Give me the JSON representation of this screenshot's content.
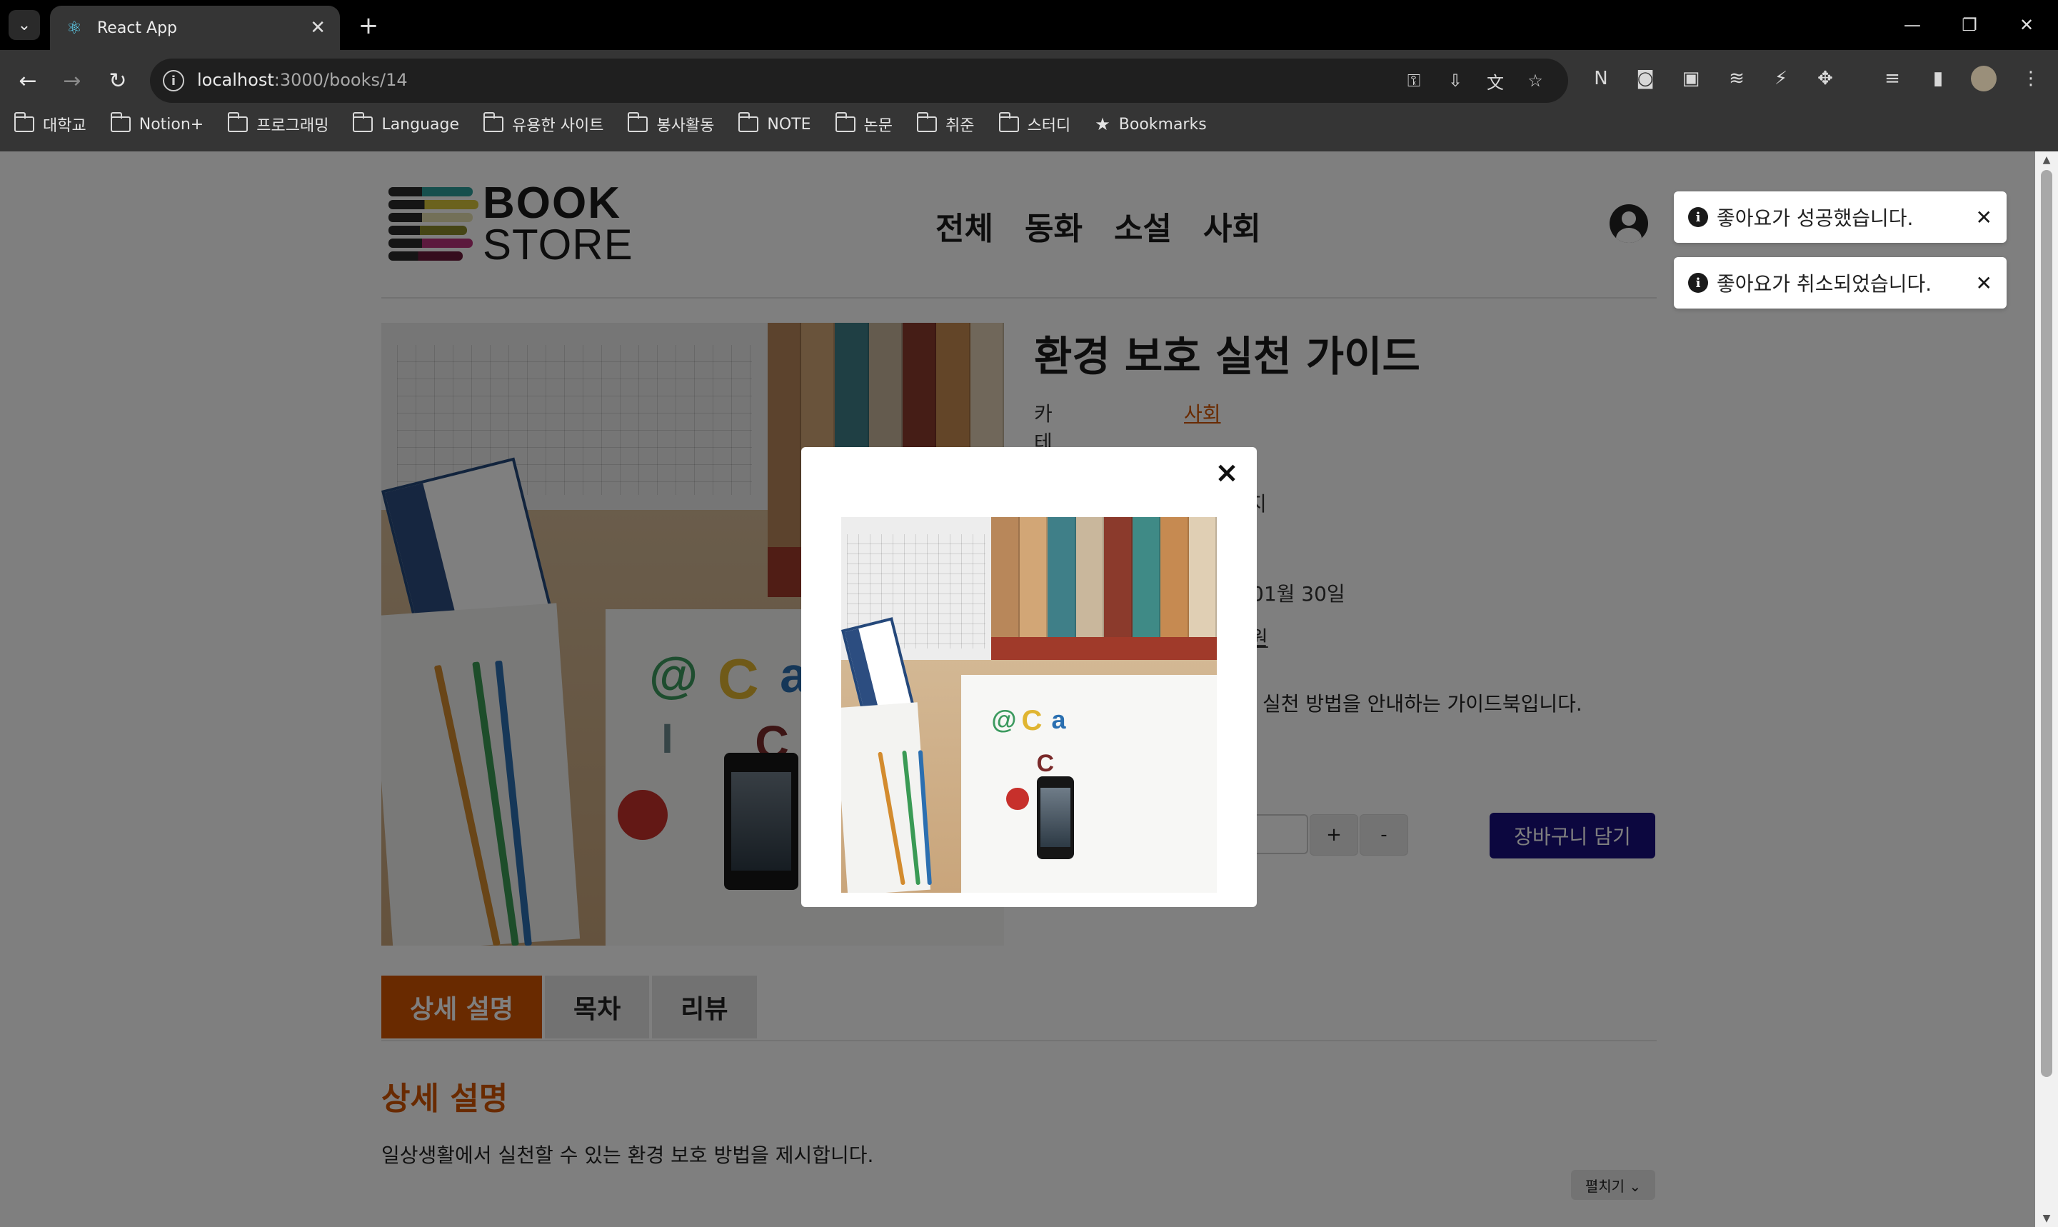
{
  "browser": {
    "tab_title": "React App",
    "url_host": "localhost",
    "url_rest": ":3000/books/14",
    "bookmarks": [
      {
        "label": "대학교",
        "type": "folder"
      },
      {
        "label": "Notion+",
        "type": "folder"
      },
      {
        "label": "프로그래밍",
        "type": "folder"
      },
      {
        "label": "Language",
        "type": "folder"
      },
      {
        "label": "유용한 사이트",
        "type": "folder"
      },
      {
        "label": "봉사활동",
        "type": "folder"
      },
      {
        "label": "NOTE",
        "type": "folder"
      },
      {
        "label": "논문",
        "type": "folder"
      },
      {
        "label": "취준",
        "type": "folder"
      },
      {
        "label": "스터디",
        "type": "folder"
      },
      {
        "label": "Bookmarks",
        "type": "star"
      }
    ]
  },
  "header": {
    "logo_line1": "BOOK",
    "logo_line2": "STORE",
    "logo_colors": [
      "#2d9f9a",
      "#d7c43a",
      "#e7e1b0",
      "#8a8a2a",
      "#b9327a",
      "#6b1a3a"
    ],
    "nav": [
      "전체",
      "동화",
      "소설",
      "사회"
    ]
  },
  "book": {
    "title": "환경 보호 실천 가이드",
    "category_label": "카테고리",
    "category_value": "사회",
    "partial_lines": [
      "지",
      "01월 30일",
      "원"
    ],
    "summary_visible": "실천 방법을 안내하는 가이드북입니다.",
    "cart_button": "장바구니 담기",
    "plus_label": "+",
    "minus_label": "-"
  },
  "tabs": {
    "items": [
      "상세 설명",
      "목차",
      "리뷰"
    ],
    "active": "상세 설명"
  },
  "detail": {
    "title": "상세 설명",
    "body": "일상생활에서 실천할 수 있는 환경 보호 방법을 제시합니다.",
    "expand_label": "펼치기 ⌄"
  },
  "toasts": [
    {
      "text": "좋아요가 성공했습니다."
    },
    {
      "text": "좋아요가 취소되었습니다."
    }
  ],
  "modal": {
    "close_label": "×"
  },
  "colors": {
    "accent": "#d35400",
    "cart_button": "#190f7f"
  }
}
